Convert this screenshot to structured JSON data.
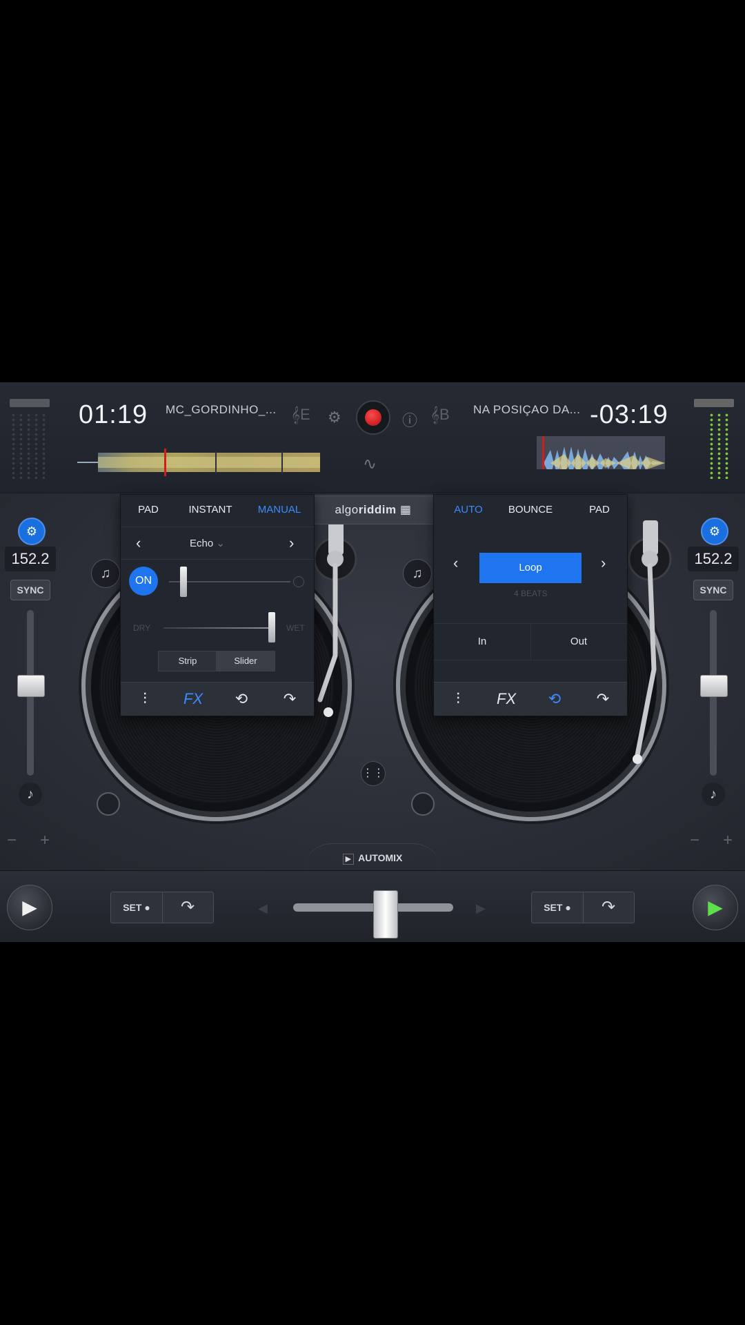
{
  "deck_left": {
    "time": "01:19",
    "track": "MC_GORDINHO_...",
    "key": "E",
    "bpm": "152.2",
    "sync": "SYNC",
    "minus": "−",
    "plus": "+"
  },
  "deck_right": {
    "time": "-03:19",
    "track": "NA POSIÇAO DA...",
    "key": "B",
    "bpm": "152.2",
    "sync": "SYNC",
    "minus": "−",
    "plus": "+"
  },
  "logo": {
    "brand_light": "algo",
    "brand_bold": "riddim"
  },
  "fx_panel": {
    "tabs": [
      "PAD",
      "INSTANT",
      "MANUAL"
    ],
    "active_tab": "MANUAL",
    "effect": "Echo",
    "on_label": "ON",
    "dry_label": "DRY",
    "wet_label": "WET",
    "mode_strip": "Strip",
    "mode_slider": "Slider",
    "selected_mode": "Slider",
    "tools_active": "FX"
  },
  "loop_panel": {
    "tabs": [
      "AUTO",
      "BOUNCE",
      "PAD"
    ],
    "active_tab": "AUTO",
    "loop_label": "Loop",
    "beats_label": "4 BEATS",
    "in_label": "In",
    "out_label": "Out",
    "tools_active": "loop"
  },
  "tools": {
    "fx": "FX"
  },
  "automix": "AUTOMIX",
  "bottom": {
    "set_label": "SET"
  },
  "colors": {
    "accent": "#1f74ef",
    "record": "#d01515",
    "play_green": "#5de04a"
  }
}
